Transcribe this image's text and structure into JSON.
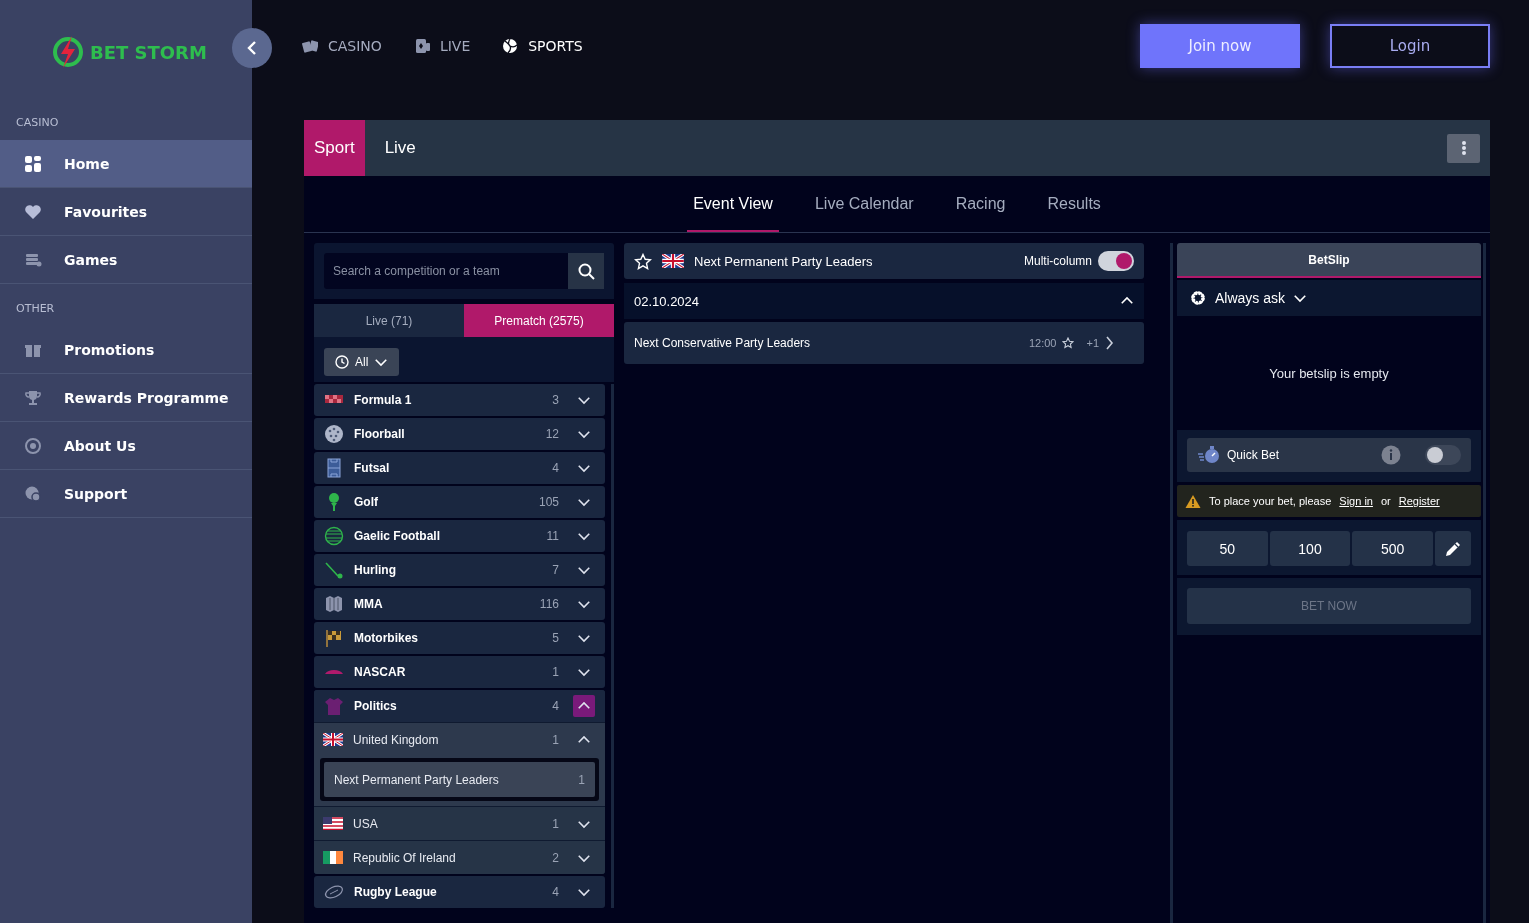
{
  "sidebar": {
    "logo_text": "BET STORM",
    "sections": [
      {
        "heading": "CASINO",
        "items": [
          {
            "label": "Home",
            "selected": true
          },
          {
            "label": "Favourites",
            "selected": false
          },
          {
            "label": "Games",
            "selected": false
          }
        ]
      },
      {
        "heading": "OTHER",
        "items": [
          {
            "label": "Promotions",
            "selected": false
          },
          {
            "label": "Rewards Programme",
            "selected": false
          },
          {
            "label": "About Us",
            "selected": false
          },
          {
            "label": "Support",
            "selected": false
          }
        ]
      }
    ]
  },
  "top_nav": [
    {
      "label": "CASINO",
      "selected": false
    },
    {
      "label": "LIVE",
      "selected": false
    },
    {
      "label": "SPORTS",
      "selected": true
    }
  ],
  "auth_buttons": [
    {
      "label": "Join now",
      "kind": "primary"
    },
    {
      "label": "Login",
      "kind": "outline"
    }
  ],
  "sport_tabs": [
    {
      "label": "Sport",
      "selected": true
    },
    {
      "label": "Live",
      "selected": false
    }
  ],
  "view_tabs": [
    {
      "label": "Event View",
      "selected": true
    },
    {
      "label": "Live Calendar",
      "selected": false
    },
    {
      "label": "Racing",
      "selected": false
    },
    {
      "label": "Results",
      "selected": false
    }
  ],
  "competitions": {
    "search": {
      "placeholder": "Search a competition or a team"
    },
    "mode_tabs": [
      {
        "label": "Live (71)",
        "selected": false
      },
      {
        "label": "Prematch (2575)",
        "selected": true
      }
    ],
    "filter": "All",
    "sports": [
      {
        "name": "Formula 1",
        "count": "3",
        "expanded": false
      },
      {
        "name": "Floorball",
        "count": "12",
        "expanded": false
      },
      {
        "name": "Futsal",
        "count": "4",
        "expanded": false
      },
      {
        "name": "Golf",
        "count": "105",
        "expanded": false
      },
      {
        "name": "Gaelic Football",
        "count": "11",
        "expanded": false
      },
      {
        "name": "Hurling",
        "count": "7",
        "expanded": false
      },
      {
        "name": "MMA",
        "count": "116",
        "expanded": false
      },
      {
        "name": "Motorbikes",
        "count": "5",
        "expanded": false
      },
      {
        "name": "NASCAR",
        "count": "1",
        "expanded": false
      },
      {
        "name": "Politics",
        "count": "4",
        "expanded": true,
        "children": [
          {
            "name": "United Kingdom",
            "count": "1",
            "expanded": true,
            "children": [
              {
                "name": "Next Permanent Party Leaders",
                "count": "1",
                "selected": true
              }
            ]
          },
          {
            "name": "USA",
            "count": "1",
            "expanded": false
          },
          {
            "name": "Republic Of Ireland",
            "count": "2",
            "expanded": false
          }
        ]
      },
      {
        "name": "Rugby League",
        "count": "4",
        "expanded": false
      }
    ]
  },
  "event": {
    "title": "Next Permanent Party Leaders",
    "multi_column": {
      "label": "Multi-column",
      "on": true
    },
    "date": "02.10.2024",
    "date_expanded": true,
    "matches": [
      {
        "name": "Next Conservative Party Leaders",
        "time": "12:00",
        "more": "+1"
      }
    ]
  },
  "betslip": {
    "title": "BetSlip",
    "odds_setting": "Always ask",
    "empty_message": "Your betslip is empty",
    "quick_bet": {
      "label": "Quick Bet",
      "on": false
    },
    "notice": {
      "text": "To place your bet, please",
      "sign_in": "Sign in",
      "or": "or",
      "register": "Register"
    },
    "stakes": [
      "50",
      "100",
      "500"
    ],
    "bet_button": {
      "label": "BET NOW",
      "disabled": true
    }
  }
}
